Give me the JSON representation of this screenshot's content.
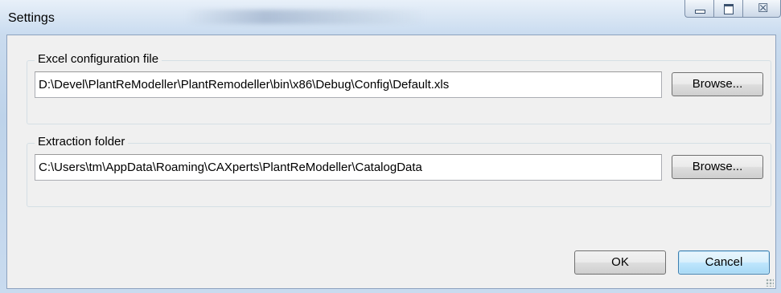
{
  "window": {
    "title": "Settings",
    "caption_buttons": {
      "minimize_icon": "minimize-icon",
      "maximize_icon": "maximize-icon",
      "close_glyph": "☒"
    }
  },
  "excel_group": {
    "label": "Excel configuration file",
    "path_value": "D:\\Devel\\PlantReModeller\\PlantRemodeller\\bin\\x86\\Debug\\Config\\Default.xls",
    "browse_label": "Browse..."
  },
  "extraction_group": {
    "label": "Extraction folder",
    "path_value": "C:\\Users\\tm\\AppData\\Roaming\\CAXperts\\PlantReModeller\\CatalogData",
    "browse_label": "Browse..."
  },
  "footer": {
    "ok_label": "OK",
    "cancel_label": "Cancel"
  },
  "colors": {
    "title_bar": "#d6e4f3",
    "client_bg": "#f0f0f0",
    "default_button_border": "#3c7fb1"
  }
}
